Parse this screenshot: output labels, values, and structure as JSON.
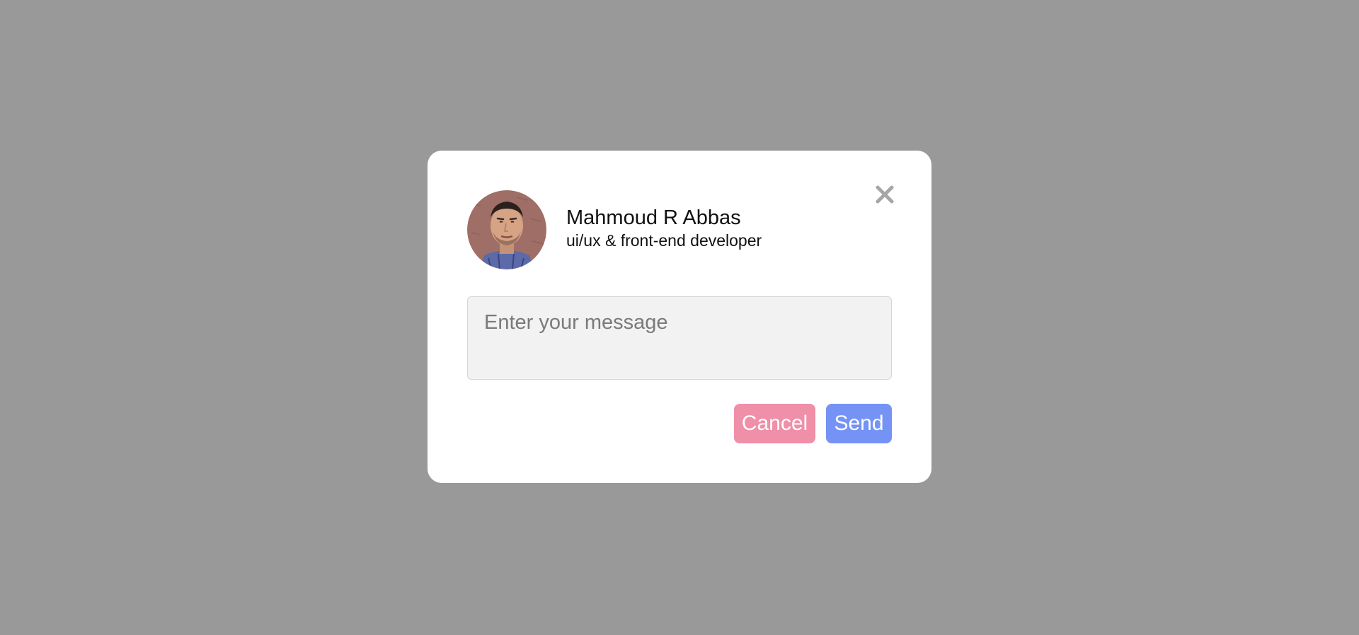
{
  "profile": {
    "name": "Mahmoud R Abbas",
    "role": "ui/ux & front-end developer"
  },
  "message": {
    "placeholder": "Enter your message",
    "value": ""
  },
  "actions": {
    "cancel_label": "Cancel",
    "send_label": "Send"
  },
  "icons": {
    "close": "close-icon"
  },
  "colors": {
    "backdrop": "#999999",
    "modal": "#ffffff",
    "cancel": "#f08fa8",
    "send": "#7493f5",
    "close_icon": "#a6a6a6"
  }
}
